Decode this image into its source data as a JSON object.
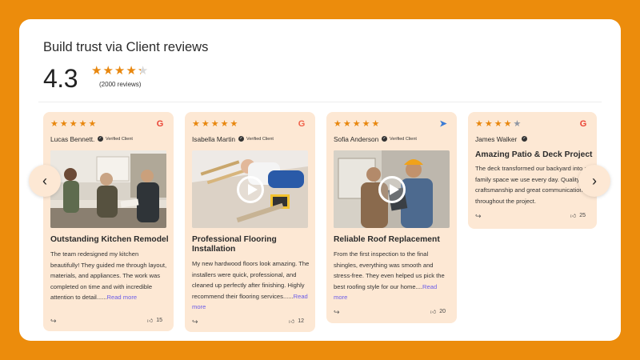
{
  "section": {
    "title": "Build trust via Client reviews",
    "rating": "4.3",
    "review_count": "(2000 reviews)",
    "stars": 4.3
  },
  "reviews": [
    {
      "stars": 5,
      "source_icon": "google-icon",
      "name": "Lucas Bennett.",
      "verified": "Verified Client",
      "has_video": false,
      "title": "Outstanding Kitchen Remodel",
      "body": "The team redesigned my kitchen beautifully! They guided me through layout, materials, and appliances. The work was completed on time and with incredible attention to detail......",
      "read_more": "Read more",
      "likes": "15"
    },
    {
      "stars": 5,
      "source_icon": "g-icon",
      "name": "Isabella Martin",
      "verified": "Verified Client",
      "has_video": true,
      "title": "Professional Flooring Installation",
      "body": "My new hardwood floors look amazing. The installers were quick, professional, and cleaned up perfectly after finishing. Highly recommend their flooring services......",
      "read_more": "Read more",
      "likes": "12"
    },
    {
      "stars": 5,
      "source_icon": "navigation-arrow-icon",
      "name": "Sofia Anderson",
      "verified": "Verified Client",
      "has_video": true,
      "title": "Reliable Roof Replacement",
      "body": "From the first inspection to the final shingles, everything was smooth and stress-free. They even helped us pick the best roofing style for our home....",
      "read_more": "Read more",
      "likes": "20"
    },
    {
      "stars": 4,
      "source_icon": "google-icon",
      "name": "James Walker",
      "verified": "",
      "has_video": false,
      "title": "Amazing Patio & Deck Project",
      "body": "The deck transformed our backyard into a family space we use every day. Quality craftsmanship and great communication throughout the project.",
      "read_more": "",
      "likes": "25"
    }
  ],
  "colors": {
    "background": "#ec8c0c",
    "card": "#fde8d4",
    "star": "#e8870e",
    "link": "#6b5ce7"
  }
}
